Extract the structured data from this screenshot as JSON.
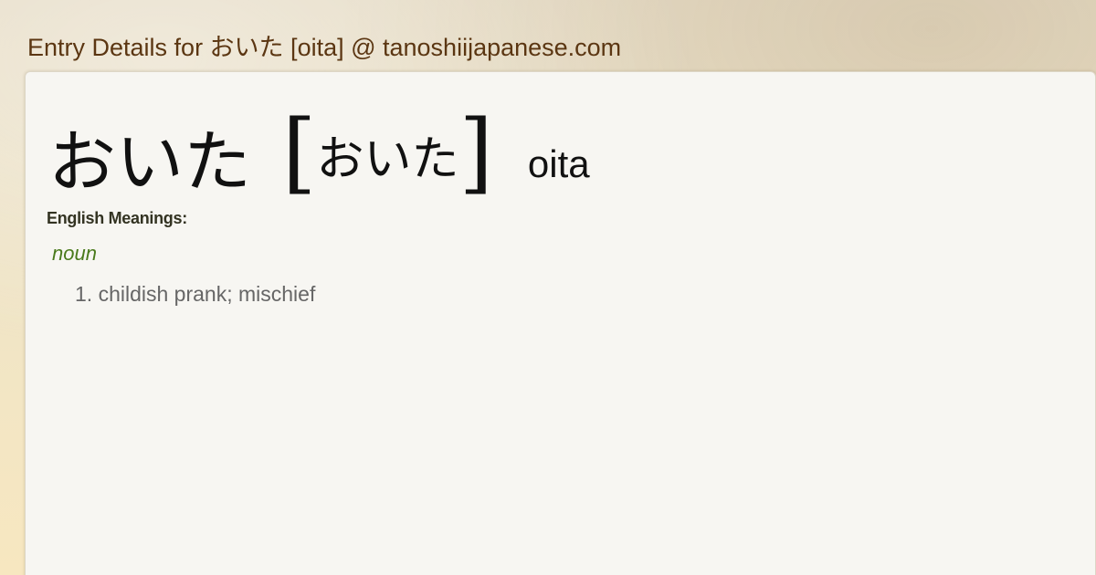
{
  "page": {
    "title": "Entry Details for おいた [oita] @ tanoshiijapanese.com"
  },
  "entry": {
    "headword": "おいた",
    "bracket_open": "[",
    "reading": "おいた",
    "bracket_close": "]",
    "romaji": "oita",
    "meanings_label": "English Meanings:",
    "part_of_speech": "noun",
    "definitions": [
      {
        "number": "1.",
        "text": "childish prank; mischief"
      }
    ]
  },
  "colors": {
    "title": "#5b3612",
    "part_of_speech": "#4a7a1c",
    "definition": "#666666",
    "card_background": "#f7f6f2"
  }
}
